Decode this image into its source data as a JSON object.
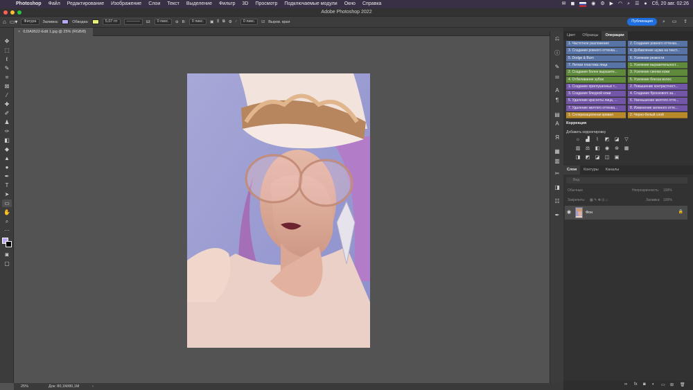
{
  "menubar": {
    "app": "Photoshop",
    "items": [
      "Файл",
      "Редактирование",
      "Изображение",
      "Слои",
      "Текст",
      "Выделение",
      "Фильтр",
      "3D",
      "Просмотр",
      "Подключаемые модули",
      "Окно",
      "Справка"
    ],
    "datetime": "Сб, 20 авг. 02:26"
  },
  "window": {
    "title": "Adobe Photoshop 2022"
  },
  "options": {
    "shape_mode": "Фигура",
    "fill_label": "Заливка:",
    "fill_color": "#b9a6f5",
    "stroke_label": "Обводка:",
    "stroke_color": "#e9f07a",
    "stroke_width": "5,07 пт",
    "w_label": "Ш:",
    "w_value": "0 пикс.",
    "h_label": "В:",
    "h_value": "0 пикс.",
    "radius_value": "0 пикс.",
    "align_edges": "Выров. края",
    "publish": "Публикация"
  },
  "document": {
    "tab": "0J3A9522-Edit 1.jpg @ 25% (RGB/8)",
    "zoom": "25%",
    "doc_info": "Док: 80,1M/80,1M"
  },
  "panels": {
    "top_tabs": [
      "Цвет",
      "Образцы",
      "Операции"
    ],
    "actions": [
      {
        "label": "1. Частотное разложение",
        "color": "#5873a6"
      },
      {
        "label": "2. Создание ровного оттенка...",
        "color": "#5873a6"
      },
      {
        "label": "3. Создание ровного оттенка...",
        "color": "#5873a6"
      },
      {
        "label": "4. Добавление шума на текст...",
        "color": "#5873a6"
      },
      {
        "label": "5. Dodge & Burn",
        "color": "#5873a6"
      },
      {
        "label": "6. Усиление резкости",
        "color": "#5873a6"
      },
      {
        "label": "7. Легкая пластика лица",
        "color": "#5873a6"
      },
      {
        "label": "1. Усиление выразительност...",
        "color": "#5f8a3c"
      },
      {
        "label": "2. Создание более выразите...",
        "color": "#5f8a3c"
      },
      {
        "label": "3. Усиление синяки кожи",
        "color": "#5f8a3c"
      },
      {
        "label": "4. Отбеливание зубов",
        "color": "#5f8a3c"
      },
      {
        "label": "5. Усиление блеска волос",
        "color": "#5f8a3c"
      },
      {
        "label": "1. Создание приглушенных т...",
        "color": "#7356a8"
      },
      {
        "label": "2. Повышение контрастност...",
        "color": "#7356a8"
      },
      {
        "label": "3. Создание бледной кожи",
        "color": "#7356a8"
      },
      {
        "label": "4. Создание бронзового за...",
        "color": "#7356a8"
      },
      {
        "label": "5. Удаление красноты лица, ...",
        "color": "#7356a8"
      },
      {
        "label": "6. Уменьшение желтого отте...",
        "color": "#7356a8"
      },
      {
        "label": "7. Удаление желтого оттенка...",
        "color": "#7356a8"
      },
      {
        "label": "8. Изменение зеленого отте...",
        "color": "#7356a8"
      },
      {
        "label": "1. Соляризационная кривая",
        "color": "#b8892a"
      },
      {
        "label": "2. Черно-белый слой",
        "color": "#b8892a"
      }
    ],
    "correction": {
      "title": "Коррекция",
      "subtitle": "Добавить корректировку"
    },
    "layer_tabs": [
      "Слои",
      "Контуры",
      "Каналы"
    ],
    "search_placeholder": "Вид",
    "blend_mode": "Обычные",
    "opacity_label": "Непрозрачность:",
    "opacity_value": "100%",
    "lock_label": "Закрепить:",
    "fill_label": "Заливка:",
    "fill_value": "100%",
    "layers": [
      {
        "name": "Фон"
      }
    ]
  }
}
